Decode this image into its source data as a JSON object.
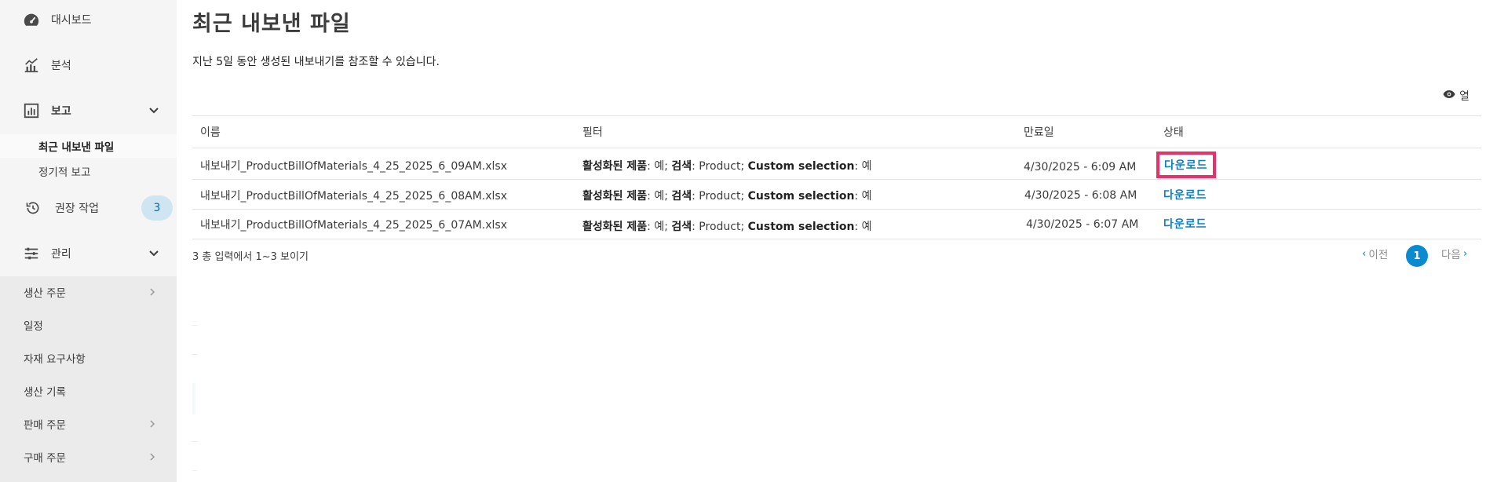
{
  "sidebar": {
    "items": [
      {
        "label": "대시보드",
        "icon": "dashboard-icon"
      },
      {
        "label": "분석",
        "icon": "analytics-icon"
      },
      {
        "label": "보고",
        "icon": "report-icon"
      },
      {
        "label": "권장 작업",
        "icon": "history-icon",
        "badge": "3"
      },
      {
        "label": "관리",
        "icon": "sliders-icon"
      }
    ],
    "report_sub": [
      {
        "label": "최근 내보낸 파일"
      },
      {
        "label": "정기적 보고"
      }
    ],
    "manage_sub": [
      {
        "label": "생산 주문"
      },
      {
        "label": "일정"
      },
      {
        "label": "자재 요구사항"
      },
      {
        "label": "생산 기록"
      },
      {
        "label": "판매 주문"
      },
      {
        "label": "구매 주문"
      }
    ]
  },
  "main": {
    "title": "최근 내보낸 파일",
    "subtitle": "지난 5일 동안 생성된 내보내기를 참조할 수 있습니다.",
    "columns_button": "열",
    "headers": {
      "name": "이름",
      "filter": "필터",
      "expiry": "만료일",
      "status": "상태"
    },
    "filter_parts": {
      "active_label": "활성화된 제품",
      "active_value": ": 예; ",
      "search_label": "검색",
      "search_value": ": Product; ",
      "custom_label": "Custom selection",
      "custom_value": ": 예"
    },
    "rows": [
      {
        "name": "내보내기_ProductBillOfMaterials_4_25_2025_6_09AM.xlsx",
        "expiry": "4/30/2025 - 6:09 AM",
        "status": "다운로드"
      },
      {
        "name": "내보내기_ProductBillOfMaterials_4_25_2025_6_08AM.xlsx",
        "expiry": "4/30/2025 - 6:08 AM",
        "status": "다운로드"
      },
      {
        "name": "내보내기_ProductBillOfMaterials_4_25_2025_6_07AM.xlsx",
        "expiry": "4/30/2025 - 6:07 AM",
        "status": "다운로드"
      }
    ],
    "footer": "3 총 입력에서 1~3 보이기",
    "pagination": {
      "prev": "이전",
      "current": "1",
      "next": "다음"
    }
  },
  "colors": {
    "accent": "#0a7fc1",
    "highlight": "#e8316a",
    "page_active": "#0a8ad1",
    "badge_bg": "#cfe6f2"
  }
}
